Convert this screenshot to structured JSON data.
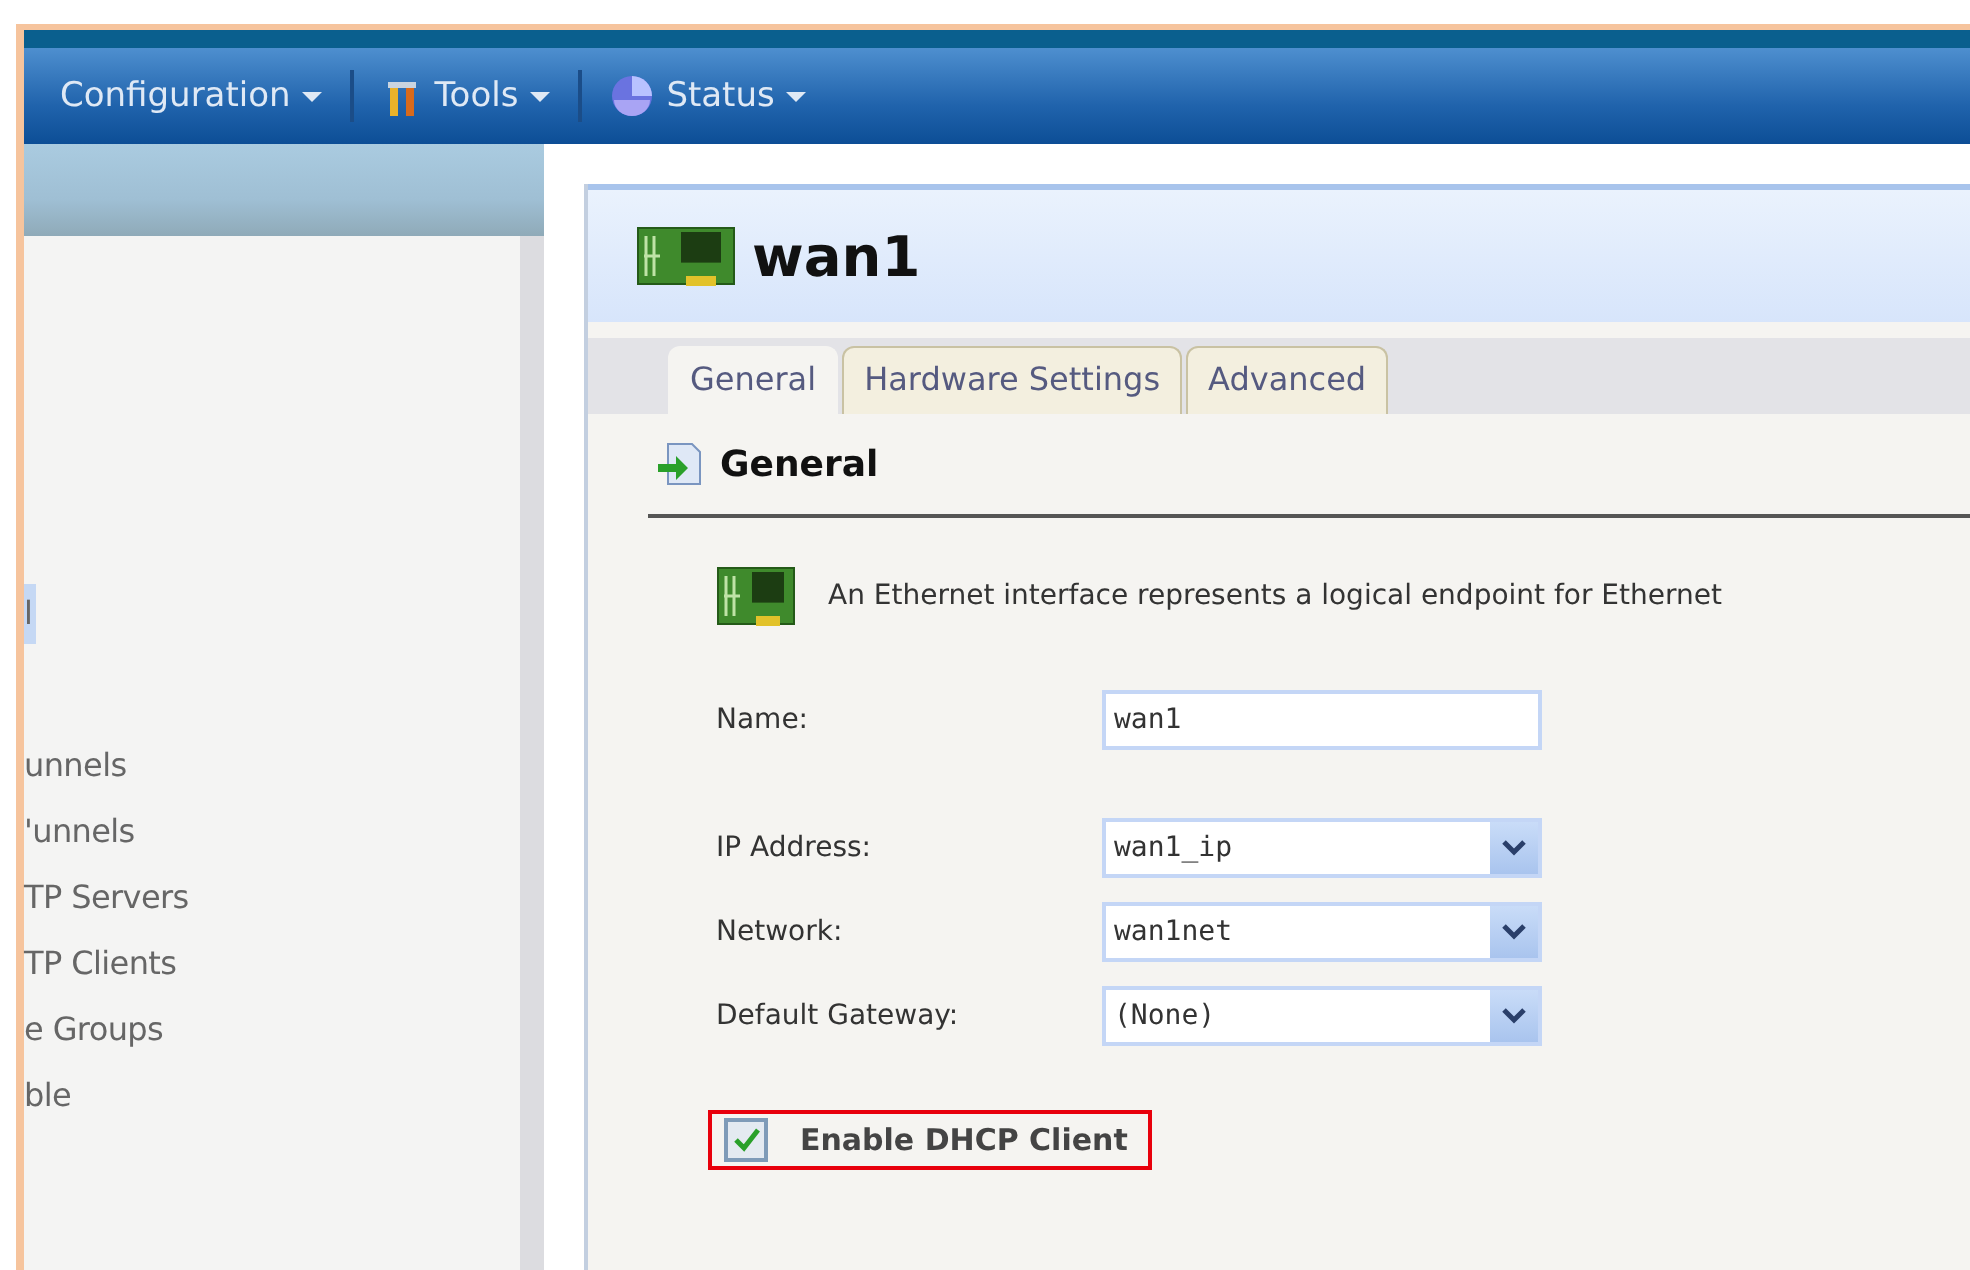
{
  "menubar": {
    "items": [
      {
        "label": "Configuration",
        "kind": "plain"
      },
      {
        "label": "Tools",
        "kind": "tools"
      },
      {
        "label": "Status",
        "kind": "status"
      }
    ]
  },
  "sidebar": {
    "items": [
      {
        "label": "l",
        "selected": true
      },
      {
        "label": "unnels",
        "selected": false
      },
      {
        "label": "'unnels",
        "selected": false
      },
      {
        "label": "TP Servers",
        "selected": false
      },
      {
        "label": "TP Clients",
        "selected": false
      },
      {
        "label": "e Groups",
        "selected": false
      },
      {
        "label": "ble",
        "selected": false
      }
    ]
  },
  "panel": {
    "title": "wan1",
    "tabs": [
      {
        "label": "General",
        "selected": true
      },
      {
        "label": "Hardware Settings",
        "selected": false
      },
      {
        "label": "Advanced",
        "selected": false
      }
    ],
    "section": "General",
    "description": "An Ethernet interface represents a logical endpoint for Ethernet",
    "fields": [
      {
        "kind": "text",
        "label": "Name:",
        "value": "wan1"
      },
      {
        "kind": "select",
        "label": "IP Address:",
        "value": "wan1_ip"
      },
      {
        "kind": "select",
        "label": "Network:",
        "value": "wan1net"
      },
      {
        "kind": "select",
        "label": "Default Gateway:",
        "value": "(None)"
      }
    ],
    "checkboxes": [
      {
        "label": "Enable DHCP Client",
        "checked": true,
        "highlighted": true
      }
    ]
  }
}
